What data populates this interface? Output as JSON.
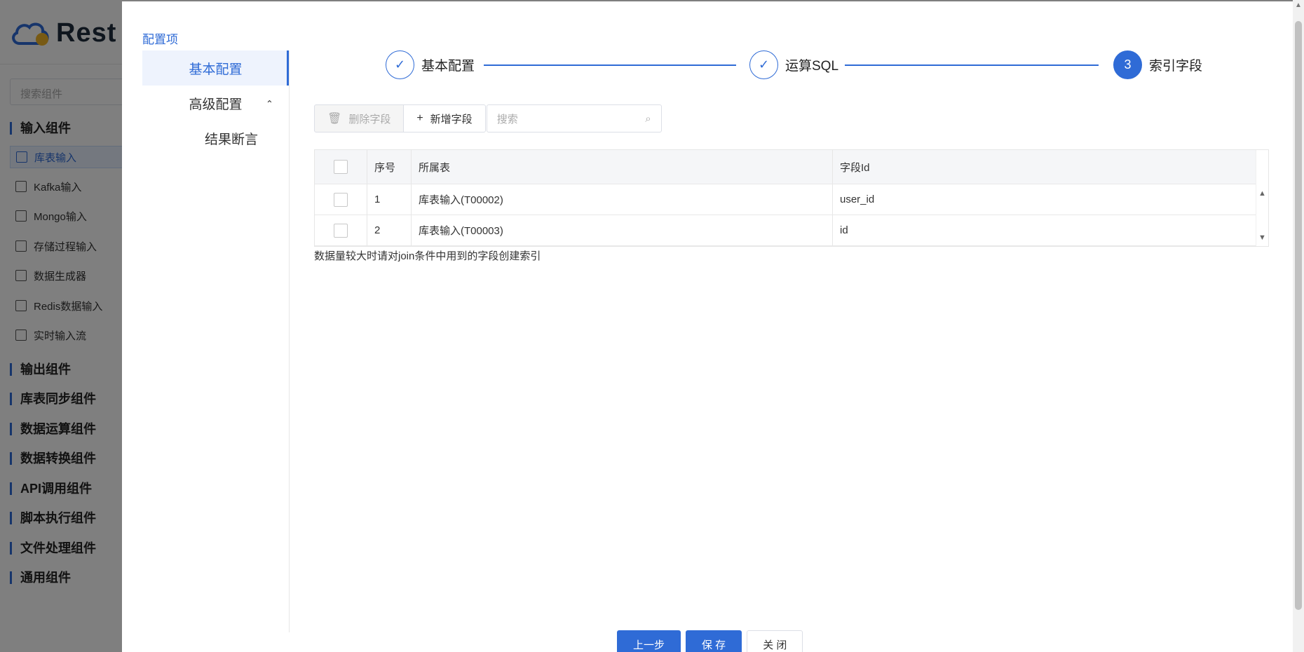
{
  "background": {
    "logo_text": "Rest",
    "search_placeholder": "搜索组件",
    "input_group": "输入组件",
    "input_items": [
      "库表输入",
      "Kafka输入",
      "Mongo输入",
      "存储过程输入",
      "数据生成器",
      "Redis数据输入",
      "实时输入流"
    ],
    "other_groups": [
      "输出组件",
      "库表同步组件",
      "数据运算组件",
      "数据转换组件",
      "API调用组件",
      "脚本执行组件",
      "文件处理组件",
      "通用组件"
    ]
  },
  "nav": {
    "title": "配置项",
    "items": [
      {
        "label": "基本配置"
      },
      {
        "label": "高级配置"
      },
      {
        "label": "结果断言"
      }
    ]
  },
  "steps": [
    {
      "label": "基本配置",
      "marker": "✓"
    },
    {
      "label": "运算SQL",
      "marker": "✓"
    },
    {
      "label": "索引字段",
      "marker": "3"
    }
  ],
  "toolbar": {
    "delete_label": "删除字段",
    "add_label": "新增字段",
    "search_placeholder": "搜索"
  },
  "table": {
    "headers": [
      "序号",
      "所属表",
      "字段Id"
    ],
    "rows": [
      {
        "index": "1",
        "table": "库表输入(T00002)",
        "field": "user_id"
      },
      {
        "index": "2",
        "table": "库表输入(T00003)",
        "field": "id"
      }
    ]
  },
  "hint": "数据量较大时请对join条件中用到的字段创建索引",
  "footer": {
    "prev_label": "上一步",
    "save_label": "保 存",
    "close_label": "关 闭"
  },
  "colors": {
    "accent": "#2f6bd6",
    "overlay": "rgba(0,0,0,0.5)"
  }
}
